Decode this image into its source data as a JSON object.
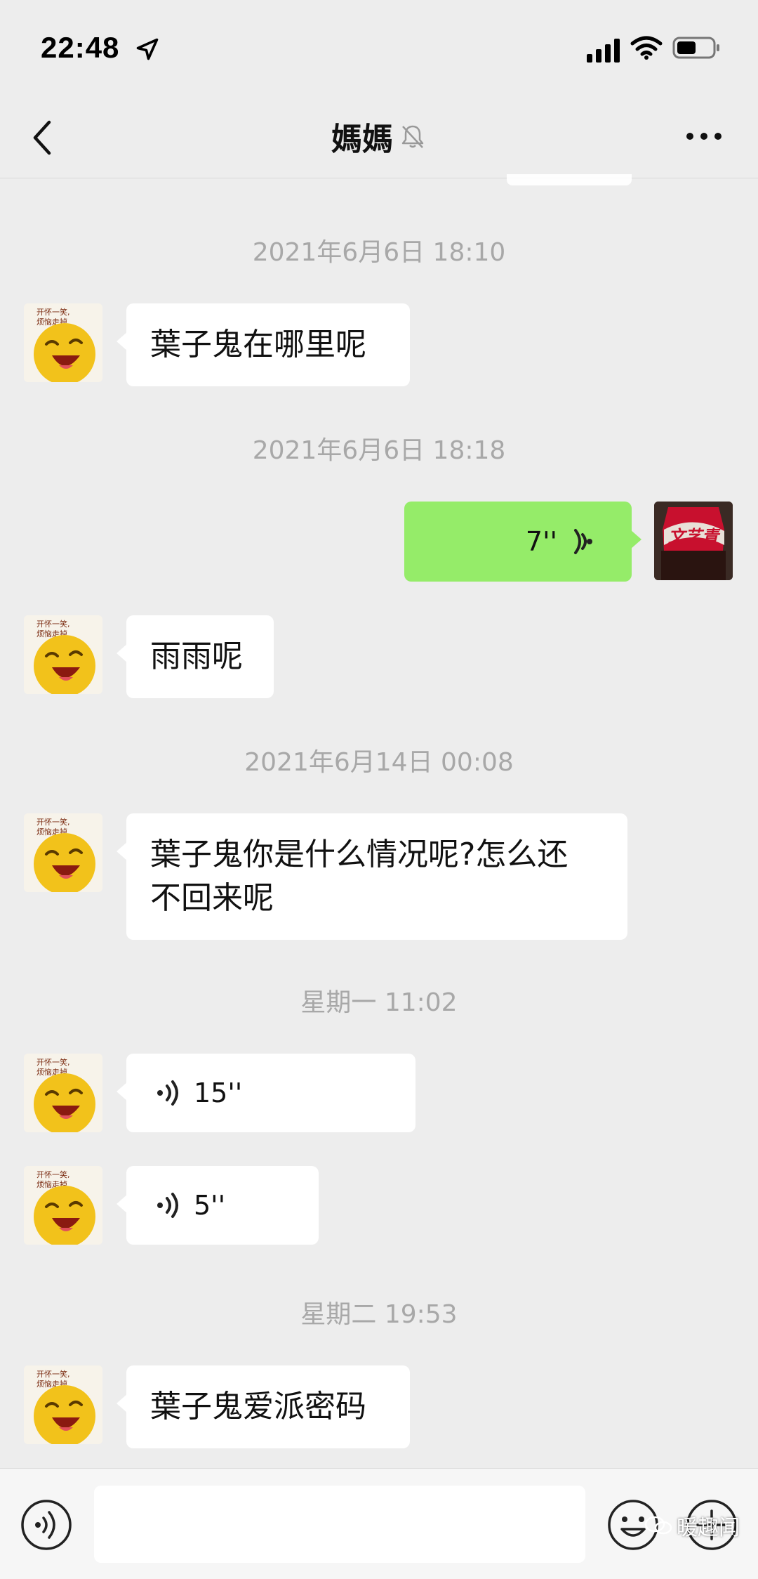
{
  "status_bar": {
    "time": "22:48"
  },
  "header": {
    "title": "媽媽"
  },
  "messages": [
    {
      "timestamp": "2021年6月6日 18:10"
    },
    {
      "text": "葉子鬼在哪里呢"
    },
    {
      "timestamp": "2021年6月6日 18:18"
    },
    {
      "voice_duration": "7''"
    },
    {
      "text": "雨雨呢"
    },
    {
      "timestamp": "2021年6月14日 00:08"
    },
    {
      "text_line1": "葉子鬼你是什么情况呢?怎么还",
      "text_line2": "不回来呢"
    },
    {
      "timestamp": "星期一 11:02"
    },
    {
      "voice_duration": "15''"
    },
    {
      "voice_duration": "5''"
    },
    {
      "timestamp": "星期二 19:53"
    },
    {
      "text": "葉子鬼爱派密码"
    }
  ],
  "avatar_text": {
    "line1": "开怀一笑,",
    "line2": "烦恼走掉."
  },
  "self_avatar_text": "文艺青",
  "input": {
    "value": ""
  },
  "watermark": "暖趣闻",
  "colors": {
    "background": "#ededed",
    "bubble_self": "#95ec69",
    "bubble_other": "#ffffff",
    "timestamp": "#a8a8a8"
  },
  "icons": [
    "location-arrow-icon",
    "signal-icon",
    "wifi-icon",
    "battery-icon",
    "back-icon",
    "mute-bell-icon",
    "more-icon",
    "voice-wave-icon",
    "voice-input-icon",
    "emoji-icon",
    "plus-icon"
  ]
}
